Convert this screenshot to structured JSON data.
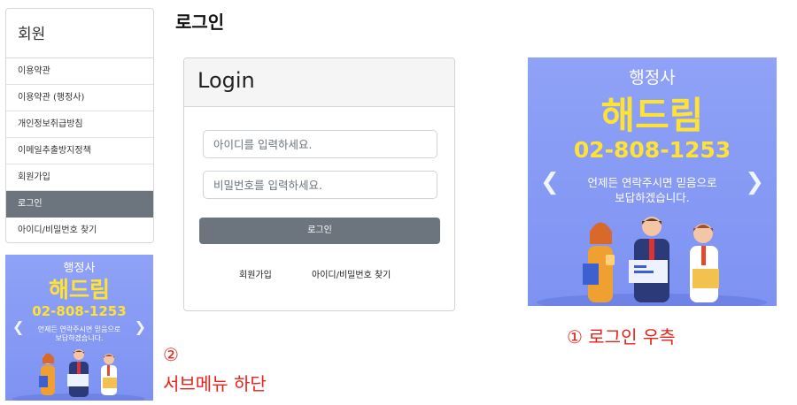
{
  "page_title": "로그인",
  "sidebar": {
    "title": "회원",
    "items": [
      {
        "label": "이용약관",
        "active": false
      },
      {
        "label": "이용약관 (행정사)",
        "active": false
      },
      {
        "label": "개인정보취급방침",
        "active": false
      },
      {
        "label": "이메일추출방지정책",
        "active": false
      },
      {
        "label": "회원가입",
        "active": false
      },
      {
        "label": "로그인",
        "active": true
      },
      {
        "label": "아이디/비밀번호 찾기",
        "active": false
      }
    ]
  },
  "login": {
    "title": "Login",
    "id_placeholder": "아이디를 입력하세요.",
    "pw_placeholder": "비밀번호를 입력하세요.",
    "button_label": "로그인",
    "signup_link": "회원가입",
    "find_link": "아이디/비밀번호 찾기"
  },
  "banner": {
    "line1": "행정사",
    "name": "해드림",
    "phone": "02-808-1253",
    "desc_line1": "언제든 연락주시면 믿음으로",
    "desc_line2": "보답하겠습니다.",
    "colors": {
      "background": "#8a9df5",
      "highlight": "#ffe234",
      "text": "#ffffff"
    }
  },
  "annotations": {
    "note1": "① 로그인 우측",
    "note2_number": "②",
    "note2_text": "서브메뉴 하단",
    "color": "#e5231b"
  },
  "colors": {
    "active_menu": "#6c757d",
    "button": "#6c757d"
  }
}
